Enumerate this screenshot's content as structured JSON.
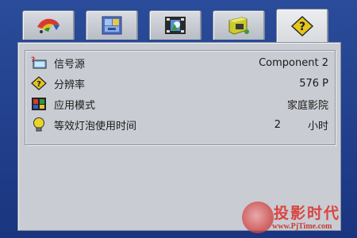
{
  "tabs": [
    {
      "icon": "color-adjust-icon",
      "active": false
    },
    {
      "icon": "image-settings-icon",
      "active": false
    },
    {
      "icon": "video-settings-icon",
      "active": false
    },
    {
      "icon": "setup-icon",
      "active": false
    },
    {
      "icon": "information-icon",
      "active": true
    }
  ],
  "info": {
    "rows": [
      {
        "icon": "signal-source-icon",
        "label": "信号源",
        "value": "Component 2"
      },
      {
        "icon": "resolution-icon",
        "label": "分辨率",
        "value": "576 P"
      },
      {
        "icon": "application-mode-icon",
        "label": "应用模式",
        "value": "家庭影院"
      },
      {
        "icon": "lamp-hours-icon",
        "label": "等效灯泡使用时间",
        "value": "2",
        "unit": "小时"
      }
    ]
  },
  "watermark": {
    "name": "投影时代",
    "url": "www.PjTime.com"
  }
}
